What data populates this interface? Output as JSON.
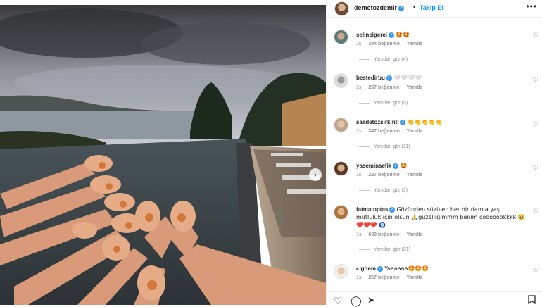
{
  "post": {
    "username": "demetozdemir",
    "follow_label": "Takip Et",
    "separator": "•",
    "more_icon": "more-horizontal-icon",
    "next_icon": "chevron-right-icon"
  },
  "comments": [
    {
      "username": "selincigerci",
      "text": "🤩🤩",
      "time": "2s",
      "likes": "304 beğenme",
      "reply": "Yanıtla",
      "view_replies": "Yanıtları gör (4)"
    },
    {
      "username": "bestedirbu",
      "text": "🤍🤍🤍🤍",
      "time": "2s",
      "likes": "257 beğenme",
      "reply": "Yanıtla",
      "view_replies": "Yanıtları gör (5)"
    },
    {
      "username": "saadetozsirkinti",
      "text": "👏👏👏👏👏",
      "time": "1s",
      "likes": "347 beğenme",
      "reply": "Yanıtla",
      "view_replies": "Yanıtları gör (11)"
    },
    {
      "username": "yaseminsefik",
      "text": "🤩",
      "time": "1s",
      "likes": "227 beğenme",
      "reply": "Yanıtla",
      "view_replies": "Yanıtları gör (1)"
    },
    {
      "username": "fatmatoptas",
      "text": "Gözünden süzülen her bir damla yaş mutluluk için olsun 🙏güzelliğimmm benim çooooookkkk 🥹❤️❤️❤️ 🧿",
      "time": "1s",
      "likes": "690 beğenme",
      "reply": "Yanıtla",
      "view_replies": "Yanıtları gör (21)"
    },
    {
      "username": "cigdem",
      "text": "Yaaaaaa🤩🤩🤩",
      "time": "1s",
      "likes": "257 beğenme",
      "reply": "Yanıtla",
      "view_replies": ""
    }
  ],
  "actions": {
    "like_icon": "heart-outline-icon",
    "comment_icon": "comment-icon",
    "share_icon": "send-icon",
    "save_icon": "bookmark-icon"
  },
  "colors": {
    "link": "#0095f6",
    "verified": "#3897f0",
    "muted": "#8e8e8e",
    "text": "#262626"
  }
}
